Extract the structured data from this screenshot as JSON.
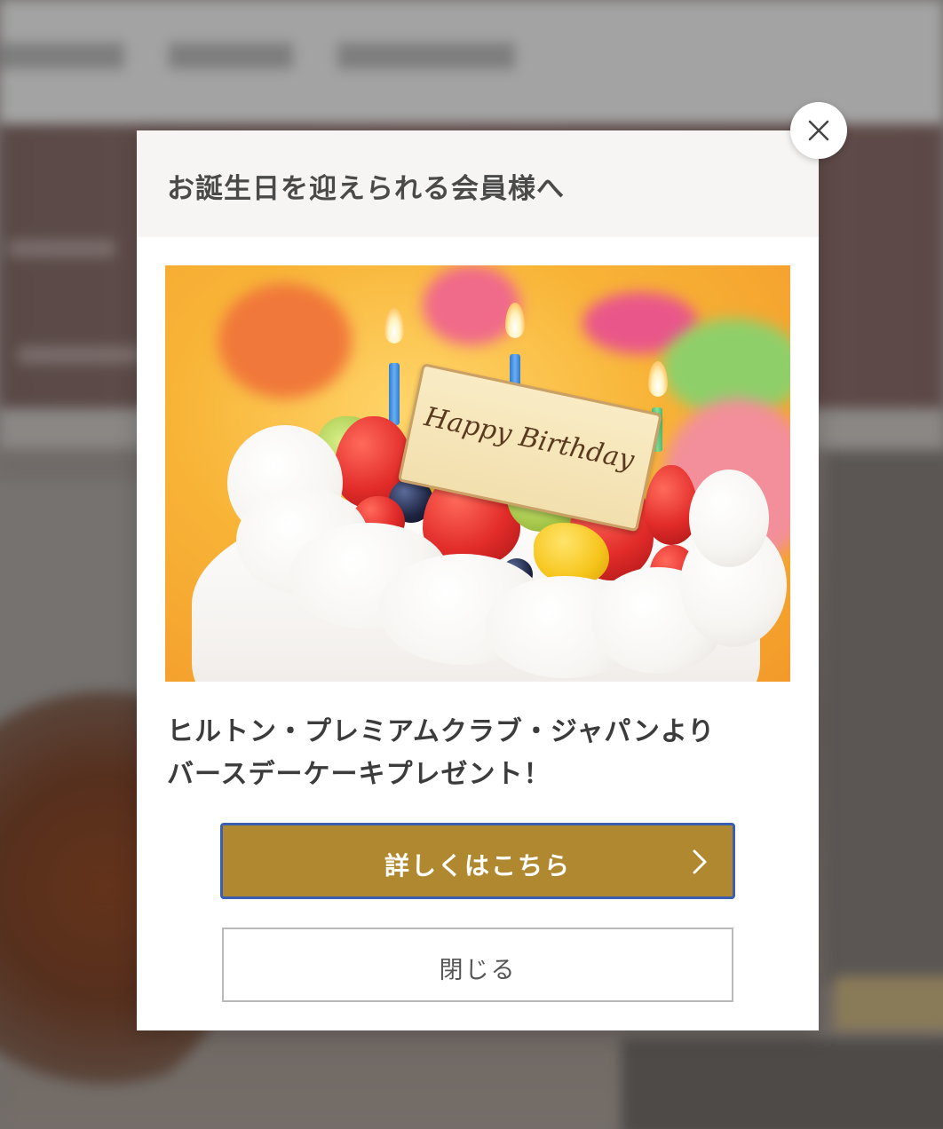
{
  "modal": {
    "title": "お誕生日を迎えられる会員様へ",
    "image": {
      "plaque_text": "Happy Birthday"
    },
    "description_lines": [
      "ヒルトン・プレミアムクラブ・ジャパンより",
      "バースデーケーキプレゼント！"
    ],
    "primary_button": {
      "label": "詳しくはこちら",
      "icon": "chevron-right-icon"
    },
    "secondary_button": {
      "label": "閉じる"
    },
    "close_icon": "close-icon"
  },
  "colors": {
    "primary_button_bg": "#b0882f",
    "primary_button_border": "#3a5fb0",
    "header_bg": "#f6f5f3",
    "title_text": "#4a4a4a"
  }
}
